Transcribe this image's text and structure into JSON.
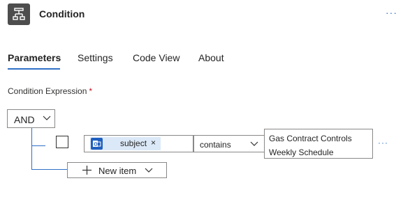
{
  "header": {
    "title": "Condition",
    "icon": "condition-branch-icon",
    "more": "···",
    "colors": {
      "icon_bg": "#4d4d4d",
      "accent": "#2f6fc6"
    }
  },
  "tabs": [
    {
      "label": "Parameters",
      "active": true
    },
    {
      "label": "Settings",
      "active": false
    },
    {
      "label": "Code View",
      "active": false
    },
    {
      "label": "About",
      "active": false
    }
  ],
  "condition": {
    "label": "Condition Expression",
    "required_mark": "*",
    "group_operator": "AND",
    "rows": [
      {
        "checked": false,
        "token": {
          "label": "subject",
          "close": "×",
          "icon": "outlook-icon"
        },
        "operator": "contains",
        "value_lines": [
          "Gas Contract Controls",
          "Weekly Schedule"
        ],
        "more": "···"
      }
    ],
    "new_item_label": "New item"
  }
}
